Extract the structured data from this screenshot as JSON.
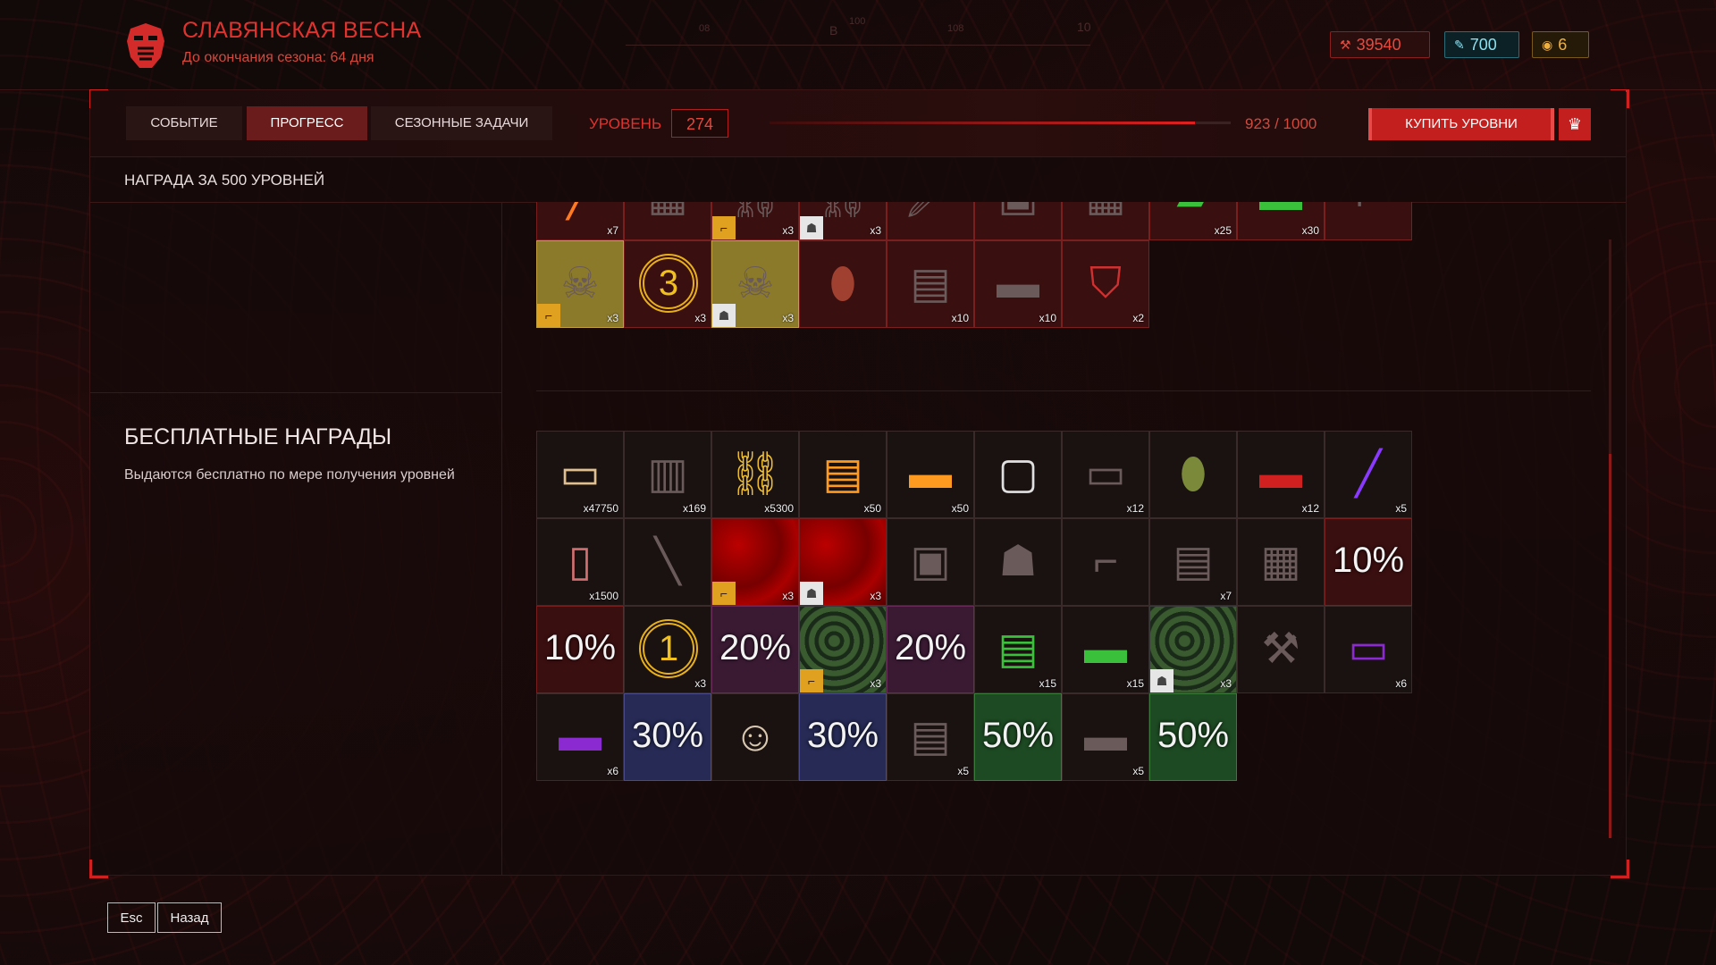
{
  "header": {
    "title": "СЛАВЯНСКАЯ ВЕСНА",
    "subtitle": "До окончания сезона: 64 дня",
    "compass_marks": [
      "100",
      "08",
      "В",
      "108",
      "10"
    ],
    "currencies": [
      {
        "value": "39540",
        "icon": "crowns-icon",
        "color": "#e74a3d"
      },
      {
        "value": "700",
        "icon": "kredits-icon",
        "color": "#8fe0ee"
      },
      {
        "value": "6",
        "icon": "coin-icon",
        "color": "#f0b040"
      }
    ]
  },
  "tabs": [
    {
      "label": "СОБЫТИЕ",
      "active": false
    },
    {
      "label": "ПРОГРЕСС",
      "active": true
    },
    {
      "label": "СЕЗОННЫЕ ЗАДАЧИ",
      "active": false
    }
  ],
  "level": {
    "label": "УРОВЕНЬ",
    "value": "274",
    "progress_text": "923 / 1000",
    "progress_fraction": 0.923
  },
  "buy_button": "КУПИТЬ УРОВНИ",
  "reward_header": "НАГРАДА ЗА 500 УРОВНЕЙ",
  "free_section": {
    "title": "БЕСПЛАТНЫЕ НАГРАДЫ",
    "description": "Выдаются бесплатно по мере получения уровней"
  },
  "premium_rows": [
    [
      {
        "icon": "glowstick-icon",
        "qty": "x7",
        "style": "premium"
      },
      {
        "icon": "crate-icon",
        "qty": "",
        "style": "premium"
      },
      {
        "icon": "chain-camo-icon",
        "qty": "x3",
        "style": "premium",
        "badge": "gun"
      },
      {
        "icon": "chain-camo-icon",
        "qty": "x3",
        "style": "premium",
        "badge": "armor"
      },
      {
        "icon": "knife-icon",
        "qty": "",
        "style": "premium"
      },
      {
        "icon": "vest-icon",
        "qty": "",
        "style": "premium"
      },
      {
        "icon": "crate-icon",
        "qty": "",
        "style": "premium"
      },
      {
        "icon": "green-box-icon",
        "qty": "x25",
        "style": "premium"
      },
      {
        "icon": "green-case-icon",
        "qty": "x30",
        "style": "premium"
      },
      {
        "icon": "holster-icon",
        "qty": "",
        "style": "premium"
      }
    ],
    [
      {
        "icon": "skull-camo-icon",
        "qty": "x3",
        "style": "yellow",
        "badge": "gun"
      },
      {
        "icon": "laurel-3-icon",
        "qty": "x3",
        "style": "premium",
        "laurel": "3"
      },
      {
        "icon": "skull-camo-icon",
        "qty": "x3",
        "style": "yellow",
        "badge": "armor"
      },
      {
        "icon": "grenade-ornament-icon",
        "qty": "",
        "style": "premium"
      },
      {
        "icon": "ammo-box-icon",
        "qty": "x10",
        "style": "premium"
      },
      {
        "icon": "ammo-case-icon",
        "qty": "x10",
        "style": "premium"
      },
      {
        "icon": "shield-icon",
        "qty": "x2",
        "style": "premium"
      }
    ]
  ],
  "free_rows": [
    [
      {
        "icon": "roubles-icon",
        "qty": "x47750"
      },
      {
        "icon": "ammo-crate-icon",
        "qty": "x169"
      },
      {
        "icon": "link-coin-icon",
        "qty": "x5300"
      },
      {
        "icon": "orange-ammo-box-icon",
        "qty": "x50"
      },
      {
        "icon": "orange-case-icon",
        "qty": "x50"
      },
      {
        "icon": "white-crate-icon",
        "qty": ""
      },
      {
        "icon": "weapon-case-icon",
        "qty": "x12"
      },
      {
        "icon": "grenade-icon",
        "qty": ""
      },
      {
        "icon": "red-case-icon",
        "qty": "x12"
      },
      {
        "icon": "purple-glowstick-icon",
        "qty": "x5"
      }
    ],
    [
      {
        "icon": "ticket-icon",
        "qty": "x1500"
      },
      {
        "icon": "rifle-icon",
        "qty": ""
      },
      {
        "icon": "red-camo-icon",
        "qty": "x3",
        "style": "redcam",
        "badge": "gun"
      },
      {
        "icon": "red-camo-icon",
        "qty": "x3",
        "style": "redcam",
        "badge": "armor"
      },
      {
        "icon": "pouch-icon",
        "qty": ""
      },
      {
        "icon": "soldier-icon",
        "qty": ""
      },
      {
        "icon": "revolver-icon",
        "qty": ""
      },
      {
        "icon": "red-crate-icon",
        "qty": "x7"
      },
      {
        "icon": "wooden-chest-icon",
        "qty": ""
      },
      {
        "icon": "discount-icon",
        "qty": "",
        "pct": "10%",
        "style": "premium"
      }
    ],
    [
      {
        "icon": "discount-icon",
        "qty": "",
        "pct": "10%",
        "style": "premium"
      },
      {
        "icon": "laurel-1-icon",
        "qty": "x3",
        "laurel": "1"
      },
      {
        "icon": "discount-icon",
        "qty": "",
        "pct": "20%",
        "style": "purple"
      },
      {
        "icon": "snake-camo-icon",
        "qty": "x3",
        "style": "snake",
        "badge": "gun"
      },
      {
        "icon": "discount-icon",
        "qty": "",
        "pct": "20%",
        "style": "purple"
      },
      {
        "icon": "green-ammo-box-icon",
        "qty": "x15"
      },
      {
        "icon": "green-case-icon",
        "qty": "x15"
      },
      {
        "icon": "snake-camo-icon",
        "qty": "x3",
        "style": "snake",
        "badge": "armor"
      },
      {
        "icon": "axe-icon",
        "qty": ""
      },
      {
        "icon": "purple-weapon-case-icon",
        "qty": "x6"
      }
    ],
    [
      {
        "icon": "purple-case-icon",
        "qty": "x6"
      },
      {
        "icon": "discount-icon",
        "qty": "",
        "pct": "30%",
        "style": "blue"
      },
      {
        "icon": "old-warrior-portrait-icon",
        "qty": ""
      },
      {
        "icon": "discount-icon",
        "qty": "",
        "pct": "30%",
        "style": "blue"
      },
      {
        "icon": "ammo-box-icon",
        "qty": "x5"
      },
      {
        "icon": "discount-icon",
        "qty": "",
        "pct": "50%",
        "style": "green"
      },
      {
        "icon": "ammo-case-icon",
        "qty": "x5"
      },
      {
        "icon": "discount-icon",
        "qty": "",
        "pct": "50%",
        "style": "green"
      }
    ]
  ],
  "footer": {
    "esc_key": "Esc",
    "back_label": "Назад"
  },
  "colors": {
    "accent": "#e0332e",
    "accent_dark": "#c31f1f",
    "background": "#120909"
  }
}
